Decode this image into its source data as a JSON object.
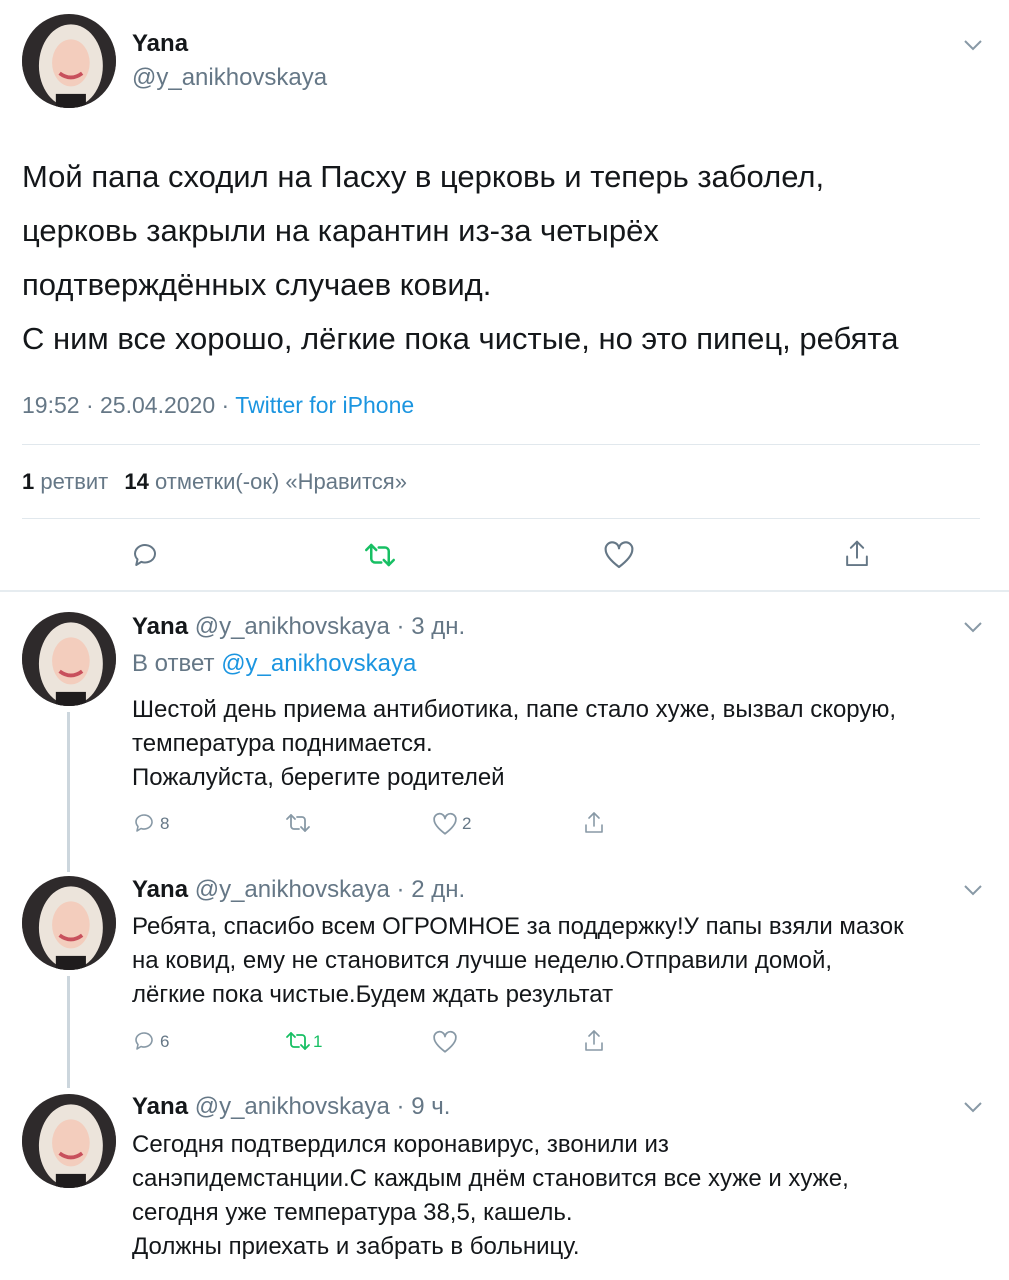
{
  "main_tweet": {
    "author_name": "Yana",
    "author_handle": "@y_anikhovskaya",
    "text_lines": [
      "Мой папа сходил на Пасху в церковь и теперь заболел,",
      "церковь закрыли на карантин из-за четырёх",
      "подтверждённых случаев ковид.",
      "С ним все хорошо, лёгкие пока чистые, но это пипец, ребята"
    ],
    "time": "19:52",
    "date": "25.04.2020",
    "separator": "·",
    "source": "Twitter for iPhone",
    "retweet_count": "1",
    "retweet_label": "ретвит",
    "likes_count": "14",
    "likes_label": "отметки(-ок) «Нравится»"
  },
  "replies": [
    {
      "author_name": "Yana",
      "author_handle": "@y_anikhovskaya",
      "age": "· 3 дн.",
      "reply_to_prefix": "В ответ",
      "reply_to_handle": "@y_anikhovskaya",
      "text_lines": [
        "Шестой день приема антибиотика, папе стало хуже, вызвал скорую,",
        "температура поднимается.",
        "Пожалуйста, берегите родителей"
      ],
      "reply_count": "8",
      "retweet_count": "",
      "like_count": "2"
    },
    {
      "author_name": "Yana",
      "author_handle": "@y_anikhovskaya",
      "age": "· 2 дн.",
      "text_lines": [
        "Ребята, спасибо всем ОГРОМНОЕ за поддержку!У папы взяли мазок",
        "на ковид, ему не становится лучше неделю.Отправили домой,",
        "лёгкие пока чистые.Будем ждать результат"
      ],
      "reply_count": "6",
      "retweet_count": "1",
      "like_count": ""
    },
    {
      "author_name": "Yana",
      "author_handle": "@y_anikhovskaya",
      "age": "· 9 ч.",
      "text_lines": [
        "Сегодня подтвердился коронавирус, звонили из",
        "санэпидемстанции.С каждым днём становится все хуже и хуже,",
        "сегодня уже температура 38,5, кашель.",
        "Должны приехать и забрать в больницу."
      ]
    }
  ],
  "icons": {
    "reply": "reply-icon",
    "retweet": "retweet-icon",
    "like": "like-icon",
    "share": "share-icon",
    "more": "chevron-down-icon"
  },
  "colors": {
    "accent": "#1b95e0",
    "retweet_green": "#17bf63",
    "grey": "#657786",
    "icon_grey": "#8899a6",
    "divider": "#e1e8ed"
  }
}
